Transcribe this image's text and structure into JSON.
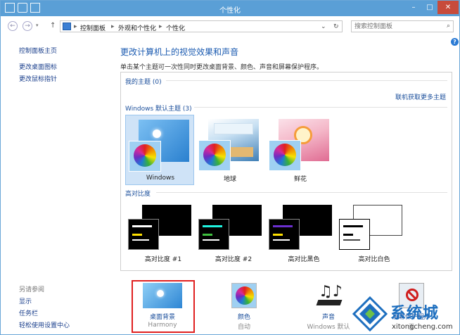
{
  "window": {
    "title": "个性化",
    "min": "–",
    "max": "□",
    "close": "✕"
  },
  "addressbar": {
    "crumbs": [
      "控制面板",
      "外观和个性化",
      "个性化"
    ],
    "search_placeholder": "搜索控制面板",
    "dropdown": "⌄",
    "refresh": "↻"
  },
  "sidebar": {
    "links": [
      "控制面板主页",
      "更改桌面图标",
      "更改鼠标指针"
    ],
    "see_also_title": "另请参阅",
    "see_also": [
      "显示",
      "任务栏",
      "轻松使用设置中心"
    ]
  },
  "main": {
    "heading": "更改计算机上的视觉效果和声音",
    "description": "单击某个主题可一次性同时更改桌面背景、颜色、声音和屏幕保护程序。"
  },
  "sections": {
    "my_themes": "我的主题 (0)",
    "get_more": "联机获取更多主题",
    "windows_default": "Windows 默认主题 (3)",
    "high_contrast": "高对比度"
  },
  "themes": [
    {
      "label": "Windows",
      "selected": true
    },
    {
      "label": "地球",
      "selected": false
    },
    {
      "label": "鲜花",
      "selected": false
    }
  ],
  "high_contrast_themes": [
    {
      "label": "高对比度 #1"
    },
    {
      "label": "高对比度 #2"
    },
    {
      "label": "高对比黑色"
    },
    {
      "label": "高对比白色"
    }
  ],
  "bottom": [
    {
      "label": "桌面背景",
      "sub": "Harmony"
    },
    {
      "label": "颜色",
      "sub": "自动"
    },
    {
      "label": "声音",
      "sub": "Windows 默认"
    },
    {
      "label": "屏幕保护程序",
      "sub": "无"
    }
  ],
  "watermark": {
    "brand": "系统城",
    "domain": "xitongcheng.com"
  }
}
